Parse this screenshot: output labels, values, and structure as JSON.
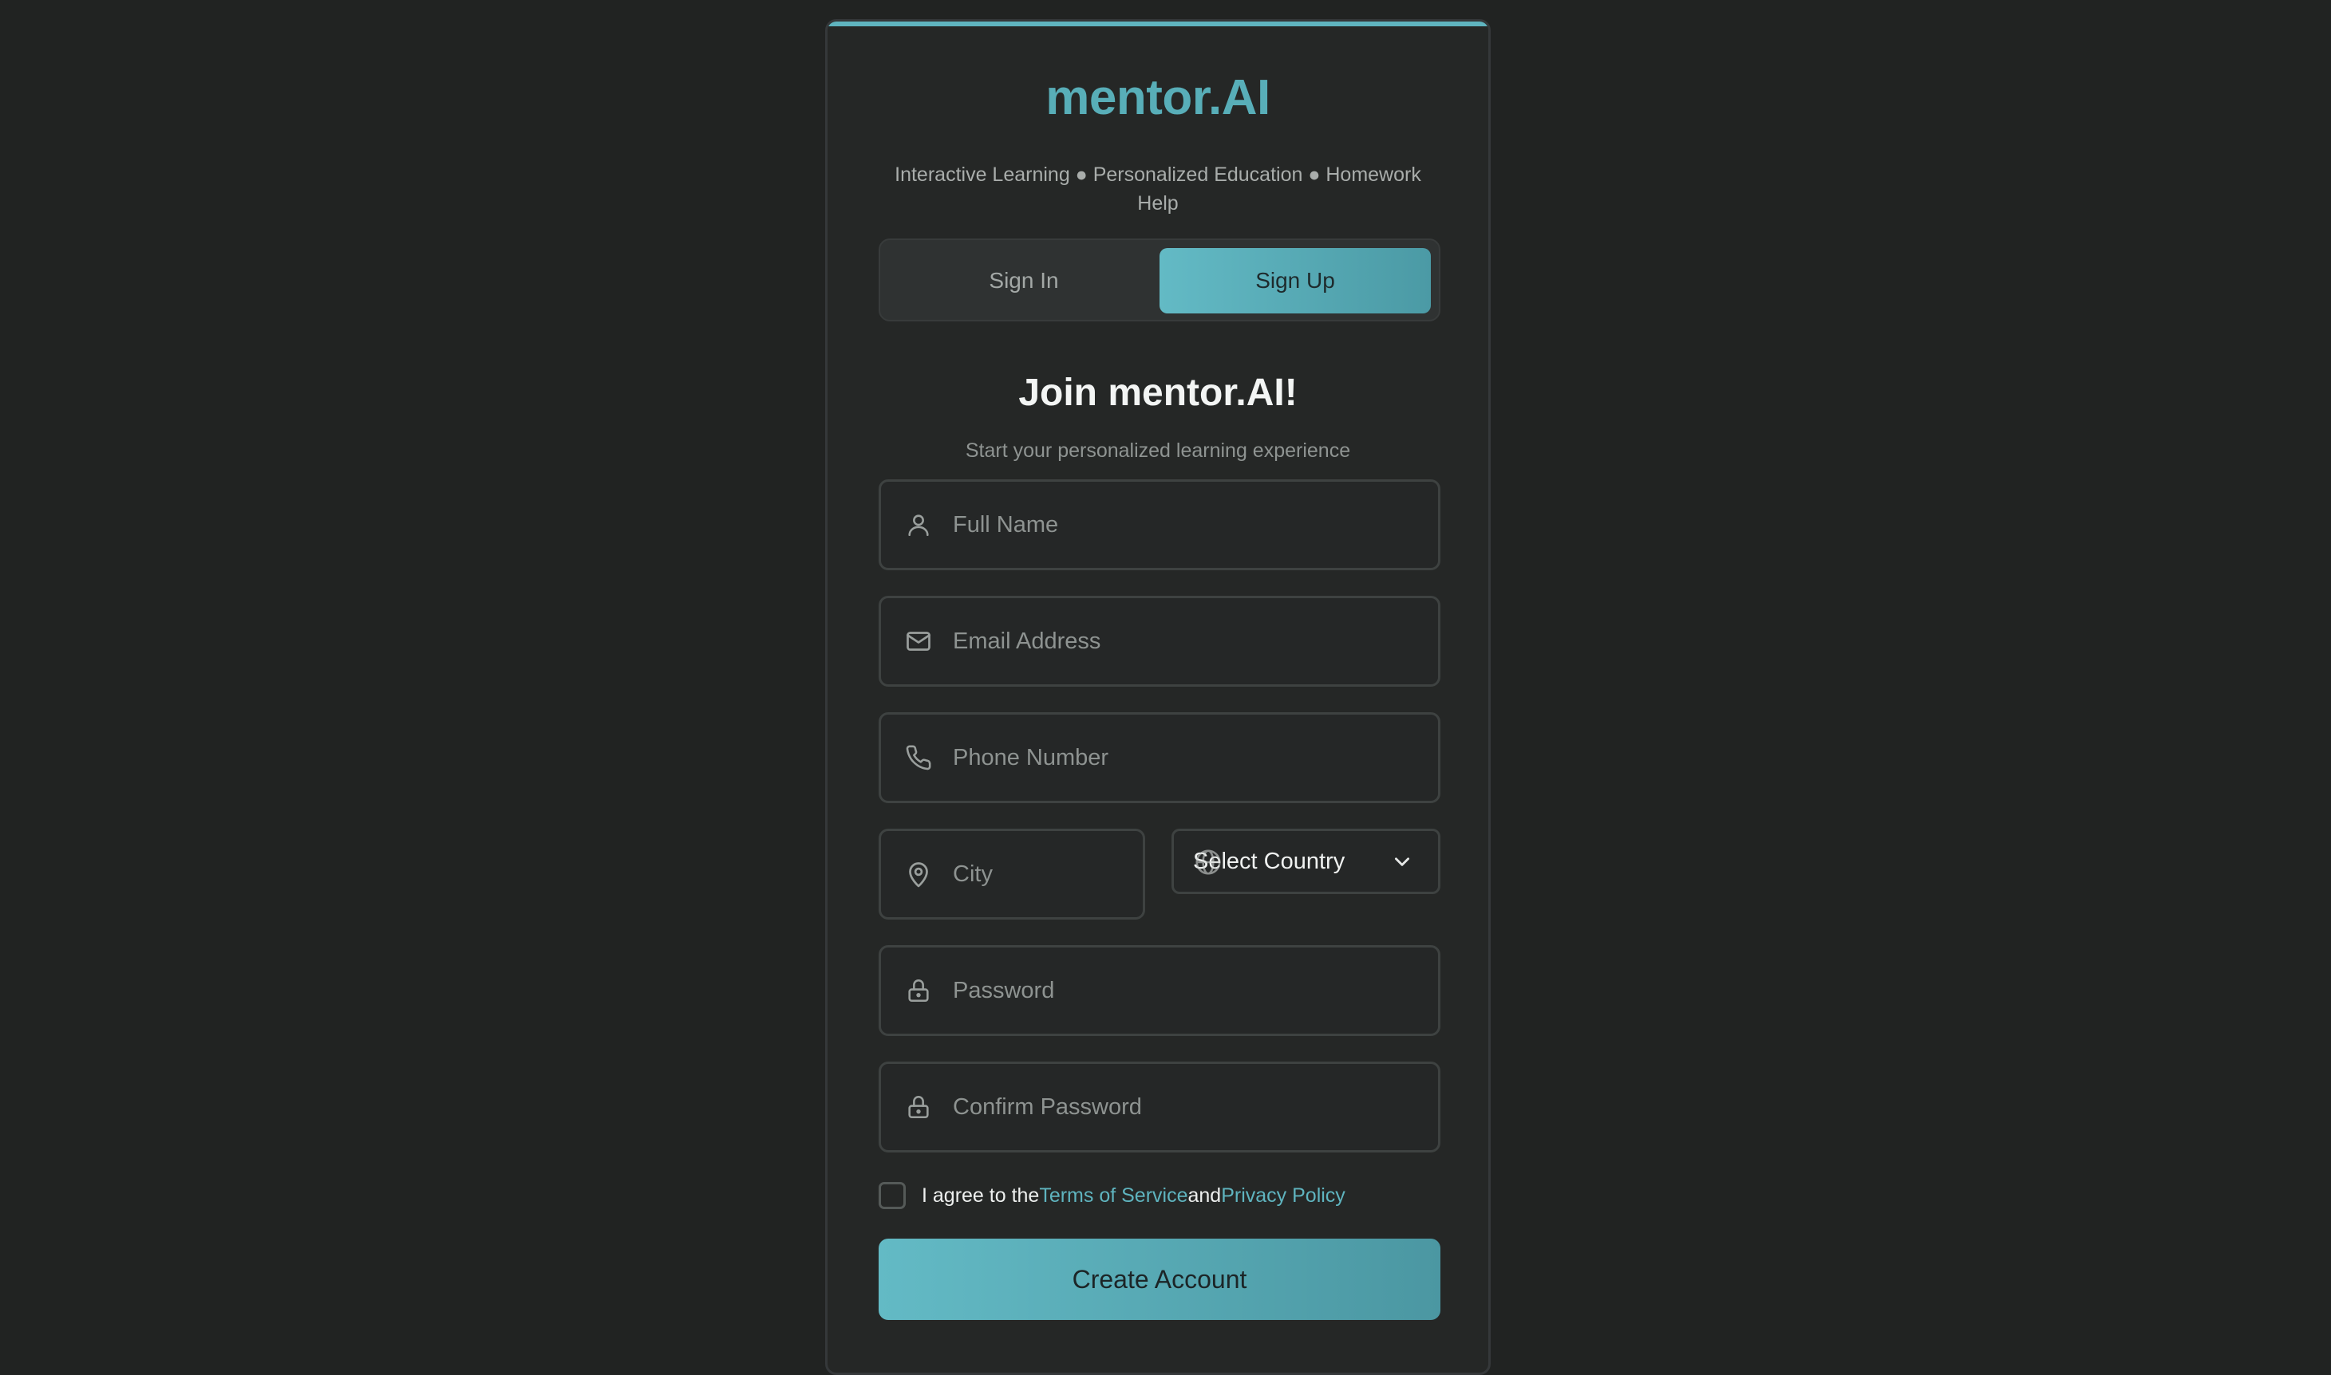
{
  "brand": {
    "name": "mentor.AI",
    "tagline": "Interactive Learning ● Personalized Education ● Homework Help"
  },
  "tabs": {
    "signin": "Sign In",
    "signup": "Sign Up",
    "active": "Sign Up"
  },
  "form": {
    "heading": "Join mentor.AI!",
    "subheading": "Start your personalized learning experience",
    "fields": {
      "full_name": {
        "placeholder": "Full Name",
        "value": "",
        "icon": "user-icon"
      },
      "email": {
        "placeholder": "Email Address",
        "value": "",
        "icon": "mail-icon"
      },
      "phone": {
        "placeholder": "Phone Number",
        "value": "",
        "icon": "phone-icon"
      },
      "city": {
        "placeholder": "City",
        "value": "",
        "icon": "map-pin-icon"
      },
      "password": {
        "placeholder": "Password",
        "value": "",
        "icon": "lock-icon"
      },
      "confirm_password": {
        "placeholder": "Confirm Password",
        "value": "",
        "icon": "lock-icon"
      }
    },
    "country_select": {
      "selected": "Select Country",
      "icon": "chevron-down-icon"
    },
    "agreement": {
      "prefix": "I agree to the",
      "terms_link": "Terms of Service",
      "middle": "and",
      "privacy_link": "Privacy Policy",
      "checked": false
    },
    "submit_label": "Create Account"
  },
  "colors": {
    "background": "#212322",
    "card": "#252726",
    "accent": "#5fb4bf",
    "text_primary": "#f3f5f4",
    "text_muted": "#8e9391"
  }
}
